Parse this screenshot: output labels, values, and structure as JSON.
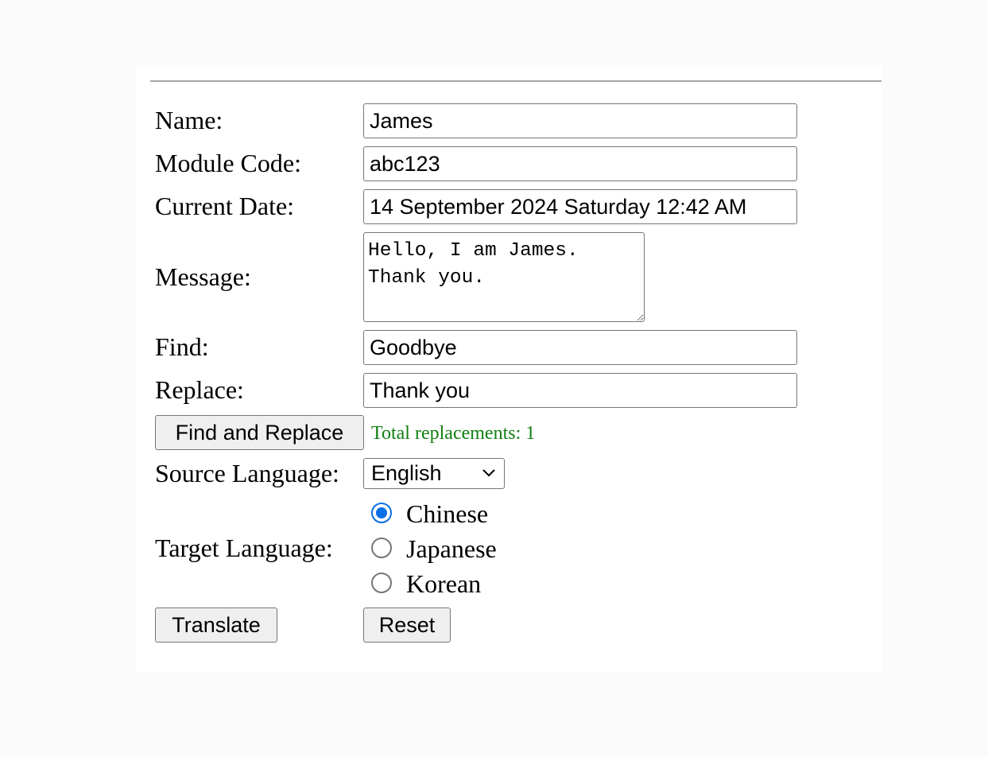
{
  "form": {
    "name": {
      "label": "Name:",
      "value": "James"
    },
    "module_code": {
      "label": "Module Code:",
      "value": "abc123"
    },
    "current_date": {
      "label": "Current Date:",
      "value": "14 September 2024 Saturday 12:42 AM"
    },
    "message": {
      "label": "Message:",
      "value": "Hello, I am James.\nThank you."
    },
    "find": {
      "label": "Find:",
      "value": "Goodbye"
    },
    "replace": {
      "label": "Replace:",
      "value": "Thank you"
    },
    "find_replace_button": "Find and Replace",
    "replacement_status": "Total replacements: 1",
    "source_language": {
      "label": "Source Language:",
      "selected": "English"
    },
    "target_language": {
      "label": "Target Language:",
      "options": [
        {
          "label": "Chinese",
          "checked": true
        },
        {
          "label": "Japanese",
          "checked": false
        },
        {
          "label": "Korean",
          "checked": false
        }
      ]
    },
    "translate_button": "Translate",
    "reset_button": "Reset"
  },
  "colors": {
    "status_text": "#118011",
    "radio_accent": "#0a6fe6",
    "page_background": "#fbfbfb"
  }
}
